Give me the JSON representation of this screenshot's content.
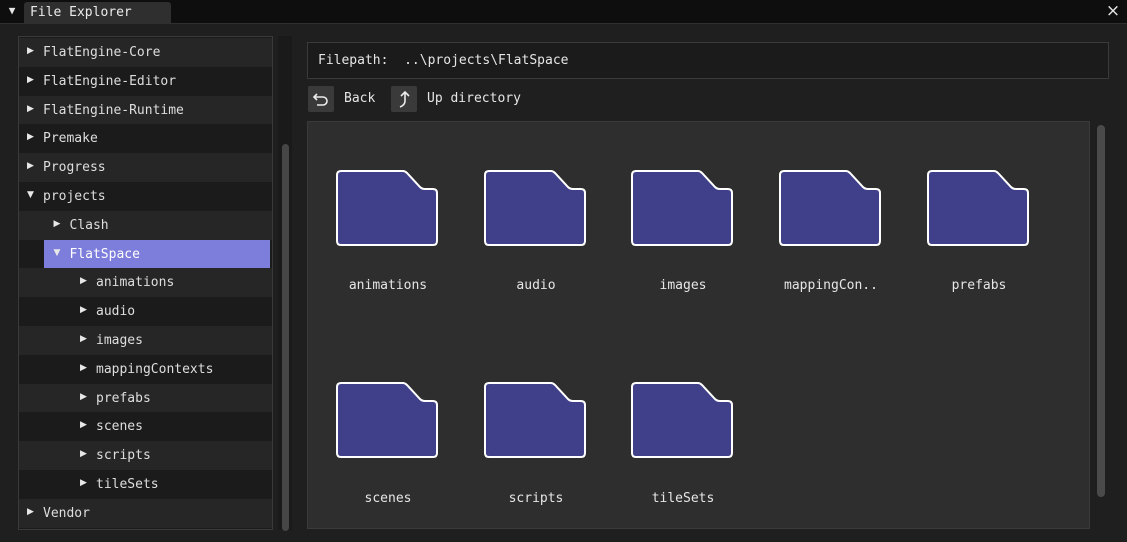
{
  "titlebar": {
    "collapse_icon": "triangle-down-icon",
    "tab_label": "File Explorer",
    "close_glyph": "×"
  },
  "tree": {
    "items": [
      {
        "label": "FlatEngine-Core",
        "level": 0,
        "expanded": false
      },
      {
        "label": "FlatEngine-Editor",
        "level": 0,
        "expanded": false
      },
      {
        "label": "FlatEngine-Runtime",
        "level": 0,
        "expanded": false
      },
      {
        "label": "Premake",
        "level": 0,
        "expanded": false
      },
      {
        "label": "Progress",
        "level": 0,
        "expanded": false
      },
      {
        "label": "projects",
        "level": 0,
        "expanded": true
      },
      {
        "label": "Clash",
        "level": 1,
        "expanded": false
      },
      {
        "label": "FlatSpace",
        "level": 1,
        "expanded": true,
        "selected": true
      },
      {
        "label": "animations",
        "level": 2,
        "expanded": false
      },
      {
        "label": "audio",
        "level": 2,
        "expanded": false
      },
      {
        "label": "images",
        "level": 2,
        "expanded": false
      },
      {
        "label": "mappingContexts",
        "level": 2,
        "expanded": false
      },
      {
        "label": "prefabs",
        "level": 2,
        "expanded": false
      },
      {
        "label": "scenes",
        "level": 2,
        "expanded": false
      },
      {
        "label": "scripts",
        "level": 2,
        "expanded": false
      },
      {
        "label": "tileSets",
        "level": 2,
        "expanded": false
      },
      {
        "label": "Vendor",
        "level": 0,
        "expanded": false
      }
    ]
  },
  "path": {
    "label": "Filepath:",
    "value": "..\\projects\\FlatSpace"
  },
  "nav": {
    "back_label": "Back",
    "up_label": "Up directory"
  },
  "folders": [
    {
      "label": "animations"
    },
    {
      "label": "audio"
    },
    {
      "label": "images"
    },
    {
      "label": "mappingCon.."
    },
    {
      "label": "prefabs"
    },
    {
      "label": "scenes"
    },
    {
      "label": "scripts"
    },
    {
      "label": "tileSets"
    }
  ],
  "colors": {
    "selected_row": "#7d7ddb",
    "folder_fill": "#40408a",
    "folder_outline": "#ffffff"
  }
}
